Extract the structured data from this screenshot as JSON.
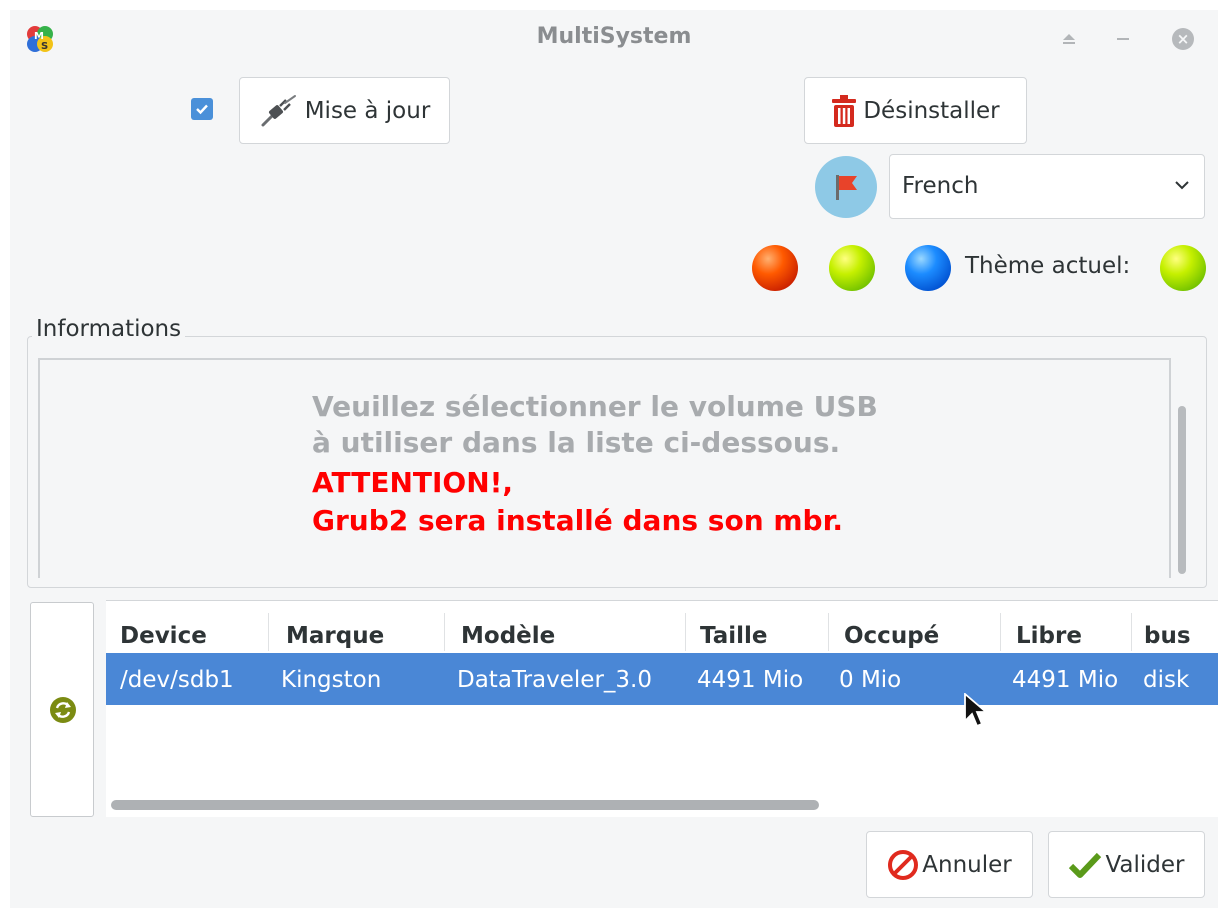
{
  "window": {
    "title": "MultiSystem"
  },
  "toolbar": {
    "update_checked": true,
    "update_label": "Mise à jour",
    "uninstall_label": "Désinstaller"
  },
  "language": {
    "selected": "French"
  },
  "theme": {
    "label": "Thème actuel:",
    "options": [
      "orange-red",
      "yellow-green",
      "blue"
    ],
    "current": "yellow-green"
  },
  "info": {
    "legend": "Informations",
    "lines": [
      "Veuillez sélectionner le volume USB",
      "à utiliser dans la liste ci-dessous.",
      "ATTENTION!,",
      "Grub2 sera installé dans son mbr."
    ]
  },
  "table": {
    "columns": [
      "Device",
      "Marque",
      "Modèle",
      "Taille",
      "Occupé",
      "Libre",
      "bus"
    ],
    "rows": [
      [
        "/dev/sdb1",
        "Kingston",
        "DataTraveler_3.0",
        "4491 Mio",
        "0 Mio",
        "4491 Mio",
        "disk"
      ]
    ]
  },
  "footer": {
    "cancel_label": "Annuler",
    "ok_label": "Valider"
  },
  "colors": {
    "selection": "#4a87d6",
    "warning": "#ff0000",
    "info_text": "#a8abae"
  }
}
